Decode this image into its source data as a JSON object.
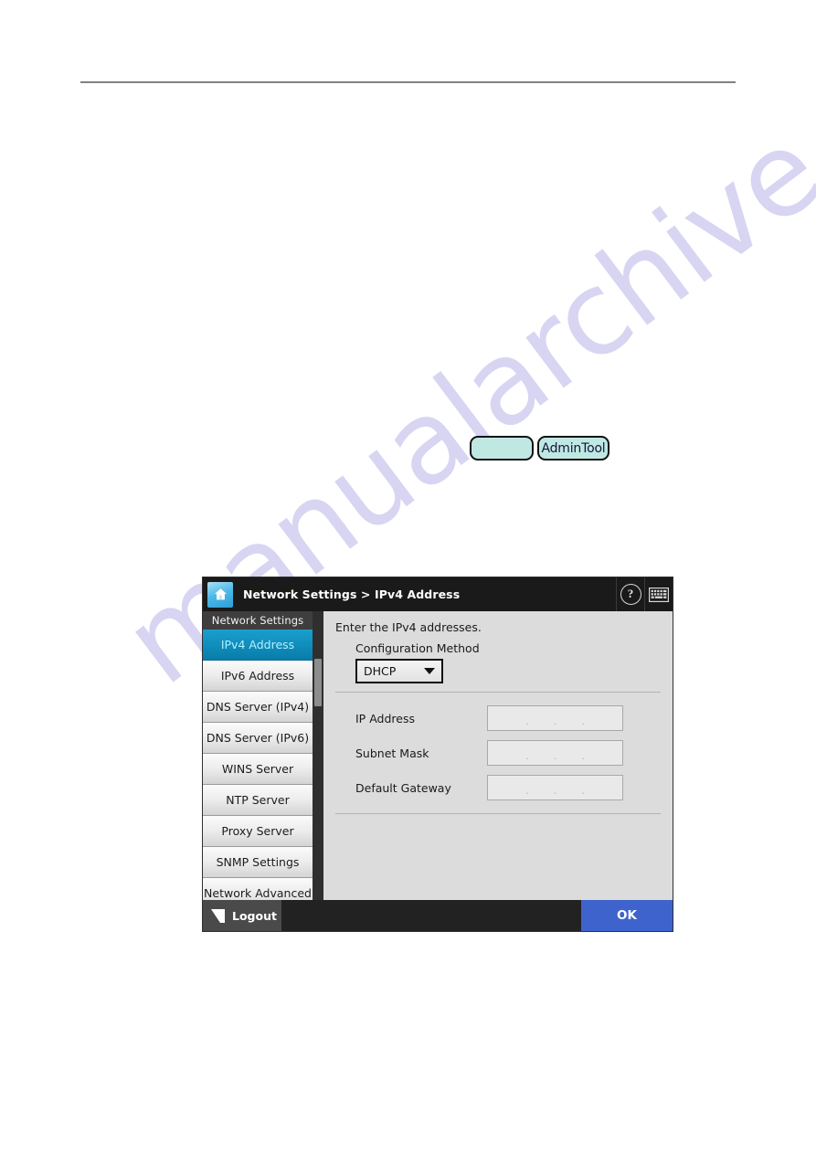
{
  "watermark": {
    "text": "manualarchive.com"
  },
  "figure_buttons": {
    "blank_label": "",
    "admin_tool_label": "AdminTool"
  },
  "device": {
    "header": {
      "home_icon": "home-icon",
      "breadcrumb": "Network Settings > IPv4 Address",
      "help_label": "?",
      "help_icon": "help-icon",
      "keyboard_icon": "keyboard-icon"
    },
    "sidebar": {
      "heading": "Network Settings",
      "items": [
        {
          "label": "IPv4 Address",
          "active": true
        },
        {
          "label": "IPv6 Address",
          "active": false
        },
        {
          "label": "DNS Server (IPv4)",
          "active": false
        },
        {
          "label": "DNS Server (IPv6)",
          "active": false
        },
        {
          "label": "WINS Server",
          "active": false
        },
        {
          "label": "NTP Server",
          "active": false
        },
        {
          "label": "Proxy Server",
          "active": false
        },
        {
          "label": "SNMP Settings",
          "active": false
        },
        {
          "label": "Network Advanced",
          "active": false
        }
      ]
    },
    "content": {
      "instruction": "Enter the IPv4 addresses.",
      "configuration_method_label": "Configuration Method",
      "configuration_method_value": "DHCP",
      "fields": [
        {
          "label": "IP Address",
          "value": ""
        },
        {
          "label": "Subnet Mask",
          "value": ""
        },
        {
          "label": "Default Gateway",
          "value": ""
        }
      ],
      "octet_separator": "."
    },
    "footer": {
      "logout_label": "Logout",
      "logout_icon": "logout-icon",
      "ok_label": "OK"
    },
    "colors": {
      "accent": "#0f8cbb",
      "active_text": "#b4f0ff",
      "ok_button": "#3f63cc",
      "header_bg": "#1a1a1a",
      "content_bg": "#dcdcdc"
    }
  }
}
